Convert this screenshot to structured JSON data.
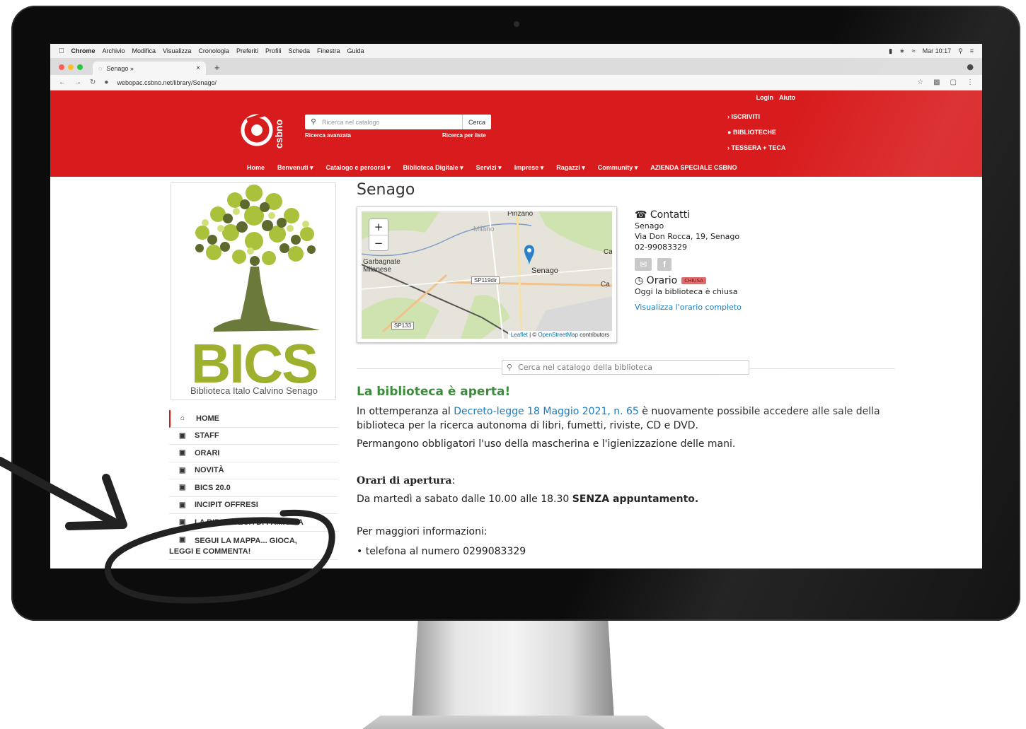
{
  "mac_menu": {
    "app": "Chrome",
    "items": [
      "Archivio",
      "Modifica",
      "Visualizza",
      "Cronologia",
      "Preferiti",
      "Profili",
      "Scheda",
      "Finestra",
      "Guida"
    ],
    "clock": "Mar 10:17"
  },
  "browser": {
    "tab_title": "Senago »",
    "new_tab": "+",
    "url": "webopac.csbno.net/library/Senago/"
  },
  "header": {
    "top_links": [
      "Login",
      "Aiuto"
    ],
    "logo_text": "csbno",
    "search_placeholder": "Ricerca nel catalogo",
    "search_button": "Cerca",
    "advanced_search": "Ricerca avanzata",
    "list_search": "Ricerca per liste",
    "right_links": [
      "ISCRIVITI",
      "BIBLIOTECHE",
      "TESSERA + TECA"
    ],
    "nav": [
      "Home",
      "Benvenuti ▾",
      "Catalogo e percorsi ▾",
      "Biblioteca Digitale ▾",
      "Servizi ▾",
      "Imprese ▾",
      "Ragazzi ▾",
      "Community ▾",
      "AZIENDA SPECIALE CSBNO"
    ]
  },
  "sidebar": {
    "logo_word": "BICS",
    "logo_subtitle": "Biblioteca Italo Calvino Senago",
    "items": [
      {
        "label": "HOME",
        "icon": "home-icon"
      },
      {
        "label": "STAFF",
        "icon": "file-icon"
      },
      {
        "label": "ORARI",
        "icon": "file-icon"
      },
      {
        "label": "NOVITÀ",
        "icon": "file-icon"
      },
      {
        "label": "BICS 20.0",
        "icon": "file-icon"
      },
      {
        "label": "INCIPIT OFFRESI",
        "icon": "file-icon"
      },
      {
        "label": "LA BIBLIOTECA DI FAMIGLIA",
        "icon": "file-icon"
      },
      {
        "label": "SEGUI LA MAPPA... GIOCA,",
        "label2": "LEGGI E COMMENTA!",
        "icon": "file-icon"
      }
    ]
  },
  "page": {
    "title": "Senago",
    "map": {
      "labels": [
        "Pinzano",
        "Milano",
        "Garbagnate Milanese",
        "Senago",
        "Ca",
        "Ca"
      ],
      "roads": [
        "SP119dir",
        "SP133"
      ],
      "zoom_in": "+",
      "zoom_out": "−",
      "attribution_leaflet": "Leaflet",
      "attribution_sep": " | © ",
      "attribution_osm": "OpenStreetMap",
      "attribution_tail": " contributors"
    },
    "contacts": {
      "heading": "Contatti",
      "name": "Senago",
      "address": "Via Don Rocca, 19, Senago",
      "phone": "02-99083329",
      "hours_heading": "Orario",
      "status_badge": "CHIUSA",
      "status_text": "Oggi la biblioteca è chiusa",
      "full_hours_link": "Visualizza l'orario completo"
    },
    "catalog_search_placeholder": "Cerca nel catalogo della biblioteca",
    "content": {
      "heading": "La biblioteca è aperta!",
      "p1_before": "In ottemperanza al ",
      "p1_link": "Decreto-legge 18 Maggio 2021, n. 65",
      "p1_after": " è nuovamente possibile accedere alle sale della biblioteca per la ricerca autonoma di libri, fumetti, riviste, CD e DVD.",
      "p2": "Permangono obbligatori l'uso della mascherina e l'igienizzazione delle mani.",
      "orari_heading": "Orari di apertura",
      "orari_colon": ":",
      "orari_before": "Da martedì a sabato dalle 10.00 alle 18.30 ",
      "orari_bold": "SENZA appuntamento.",
      "info": "Per maggiori informazioni:",
      "bullet": "• telefona al numero 0299083329"
    }
  },
  "colors": {
    "brand_red": "#d81c1d",
    "link_blue": "#1a7bc0",
    "heading_green": "#3d8b3d",
    "bics_green": "#9fb02f"
  }
}
